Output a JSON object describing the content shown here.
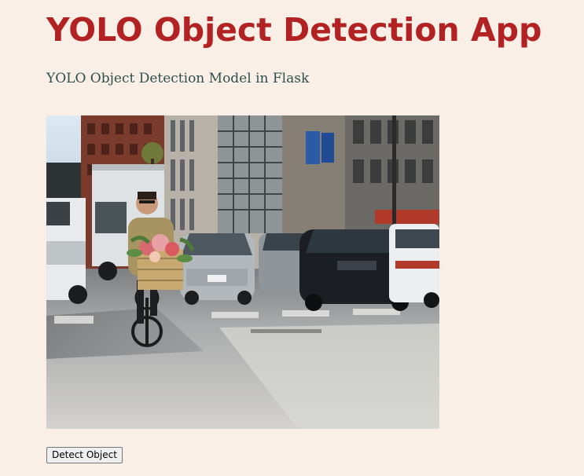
{
  "page": {
    "title": "YOLO Object Detection App",
    "subtitle": "YOLO Object Detection Model in Flask"
  },
  "image": {
    "subject": "street-scene-cyclist-with-flower-basket"
  },
  "actions": {
    "detect_label": "Detect Object"
  },
  "colors": {
    "background": "#faefe6",
    "title": "#b22222",
    "subtitle": "#2f4f4f"
  }
}
